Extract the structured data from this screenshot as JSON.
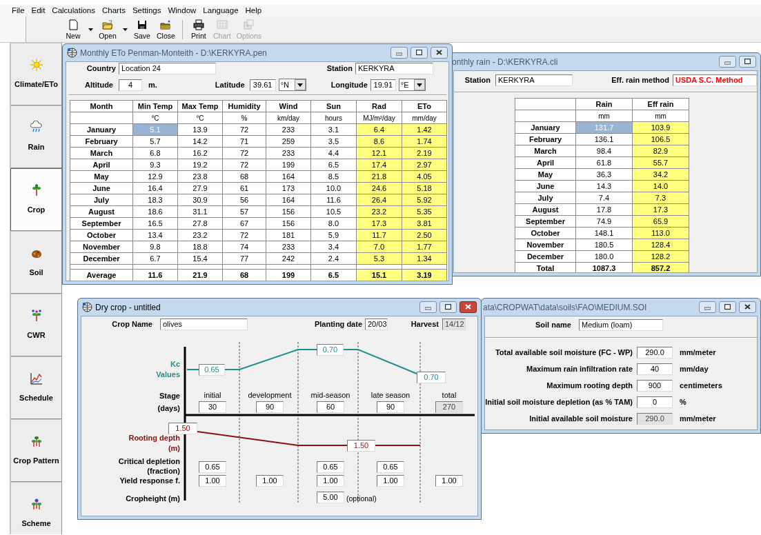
{
  "menu": [
    "File",
    "Edit",
    "Calculations",
    "Charts",
    "Settings",
    "Window",
    "Language",
    "Help"
  ],
  "toolbar": [
    {
      "label": "New",
      "dropdown": true,
      "disabled": false
    },
    {
      "label": "Open",
      "dropdown": true,
      "disabled": false
    },
    {
      "label": "Save",
      "dropdown": false,
      "disabled": false
    },
    {
      "label": "Close",
      "dropdown": false,
      "disabled": false
    },
    {
      "label": "Print",
      "dropdown": false,
      "disabled": false,
      "separator_before": true
    },
    {
      "label": "Chart",
      "dropdown": false,
      "disabled": true
    },
    {
      "label": "Options",
      "dropdown": false,
      "disabled": true
    }
  ],
  "sidebar": [
    {
      "label": "Climate/ETo",
      "selected": false
    },
    {
      "label": "Rain",
      "selected": false
    },
    {
      "label": "Crop",
      "selected": true
    },
    {
      "label": "Soil",
      "selected": false
    },
    {
      "label": "CWR",
      "selected": false
    },
    {
      "label": "Schedule",
      "selected": false
    },
    {
      "label": "Crop Pattern",
      "selected": false
    },
    {
      "label": "Scheme",
      "selected": false
    }
  ],
  "rain_window": {
    "title": "onthly rain - D:\\KERKYRA.cli",
    "active": false,
    "station": {
      "label": "Station",
      "value": "KERKYRA"
    },
    "eff_rain_method": {
      "label": "Eff. rain method",
      "value": "USDA S.C. Method"
    },
    "table": {
      "columns": [
        {
          "header": "Rain",
          "unit": "mm",
          "computed": false
        },
        {
          "header": "Eff rain",
          "unit": "mm",
          "computed": true
        }
      ],
      "rows": [
        {
          "month": "January",
          "values": [
            "131.7",
            "103.9"
          ],
          "selected": true
        },
        {
          "month": "February",
          "values": [
            "136.1",
            "106.5"
          ],
          "selected": false
        },
        {
          "month": "March",
          "values": [
            "98.4",
            "82.9"
          ],
          "selected": false
        },
        {
          "month": "April",
          "values": [
            "61.8",
            "55.7"
          ],
          "selected": false
        },
        {
          "month": "May",
          "values": [
            "36.3",
            "34.2"
          ],
          "selected": false
        },
        {
          "month": "June",
          "values": [
            "14.3",
            "14.0"
          ],
          "selected": false
        },
        {
          "month": "July",
          "values": [
            "7.4",
            "7.3"
          ],
          "selected": false
        },
        {
          "month": "August",
          "values": [
            "17.8",
            "17.3"
          ],
          "selected": false
        },
        {
          "month": "September",
          "values": [
            "74.9",
            "65.9"
          ],
          "selected": false
        },
        {
          "month": "October",
          "values": [
            "148.1",
            "113.0"
          ],
          "selected": false
        },
        {
          "month": "November",
          "values": [
            "180.5",
            "128.4"
          ],
          "selected": false
        },
        {
          "month": "December",
          "values": [
            "180.0",
            "128.2"
          ],
          "selected": false
        }
      ],
      "footer": {
        "label": "Total",
        "values": [
          "1087.3",
          "857.2"
        ]
      }
    }
  },
  "eto_window": {
    "title": "Monthly ETo Penman-Monteith - D:\\KERKYRA.pen",
    "active": false,
    "country": {
      "label": "Country",
      "value": "Location 24"
    },
    "station": {
      "label": "Station",
      "value": "KERKYRA"
    },
    "altitude": {
      "label": "Altitude",
      "value": "4",
      "unit": "m."
    },
    "latitude": {
      "label": "Latitude",
      "value": "39.61",
      "hemisphere": "°N"
    },
    "longitude": {
      "label": "Longitude",
      "value": "19.91",
      "hemisphere": "°E"
    },
    "table": {
      "first_header": "Month",
      "columns": [
        {
          "header": "Min Temp",
          "unit": "°C",
          "computed": false
        },
        {
          "header": "Max Temp",
          "unit": "°C",
          "computed": false
        },
        {
          "header": "Humidity",
          "unit": "%",
          "computed": false
        },
        {
          "header": "Wind",
          "unit": "km/day",
          "computed": false
        },
        {
          "header": "Sun",
          "unit": "hours",
          "computed": false
        },
        {
          "header": "Rad",
          "unit": "MJ/m²/day",
          "computed": true
        },
        {
          "header": "ETo",
          "unit": "mm/day",
          "computed": true
        }
      ],
      "rows": [
        {
          "month": "January",
          "values": [
            "5.1",
            "13.9",
            "72",
            "233",
            "3.1",
            "6.4",
            "1.42"
          ],
          "selected": true
        },
        {
          "month": "February",
          "values": [
            "5.7",
            "14.2",
            "71",
            "259",
            "3.5",
            "8.6",
            "1.74"
          ],
          "selected": false
        },
        {
          "month": "March",
          "values": [
            "6.8",
            "16.2",
            "72",
            "233",
            "4.4",
            "12.1",
            "2.19"
          ],
          "selected": false
        },
        {
          "month": "April",
          "values": [
            "9.3",
            "19.2",
            "72",
            "199",
            "6.5",
            "17.4",
            "2.97"
          ],
          "selected": false
        },
        {
          "month": "May",
          "values": [
            "12.9",
            "23.8",
            "68",
            "164",
            "8.5",
            "21.8",
            "4.05"
          ],
          "selected": false
        },
        {
          "month": "June",
          "values": [
            "16.4",
            "27.9",
            "61",
            "173",
            "10.0",
            "24.6",
            "5.18"
          ],
          "selected": false
        },
        {
          "month": "July",
          "values": [
            "18.3",
            "30.9",
            "56",
            "164",
            "11.6",
            "26.4",
            "5.92"
          ],
          "selected": false
        },
        {
          "month": "August",
          "values": [
            "18.6",
            "31.1",
            "57",
            "156",
            "10.5",
            "23.2",
            "5.35"
          ],
          "selected": false
        },
        {
          "month": "September",
          "values": [
            "16.5",
            "27.8",
            "67",
            "156",
            "8.0",
            "17.3",
            "3.81"
          ],
          "selected": false
        },
        {
          "month": "October",
          "values": [
            "13.4",
            "23.2",
            "72",
            "181",
            "5.9",
            "11.7",
            "2.50"
          ],
          "selected": false
        },
        {
          "month": "November",
          "values": [
            "9.8",
            "18.8",
            "74",
            "233",
            "3.4",
            "7.0",
            "1.77"
          ],
          "selected": false
        },
        {
          "month": "December",
          "values": [
            "6.7",
            "15.4",
            "77",
            "242",
            "2.4",
            "5.3",
            "1.34"
          ],
          "selected": false
        }
      ],
      "footer": {
        "label": "Average",
        "values": [
          "11.6",
          "21.9",
          "68",
          "199",
          "6.5",
          "15.1",
          "3.19"
        ]
      }
    }
  },
  "soil_window": {
    "title": "ata\\CROPWAT\\data\\soils\\FAO\\MEDIUM.SOI",
    "active": false,
    "soil_name": {
      "label": "Soil name",
      "value": "Medium (loam)"
    },
    "rows": [
      {
        "label": "Total available soil moisture (FC - WP)",
        "value": "290.0",
        "unit": "mm/meter",
        "readonly": false
      },
      {
        "label": "Maximum rain infiltration rate",
        "value": "40",
        "unit": "mm/day",
        "readonly": false
      },
      {
        "label": "Maximum rooting depth",
        "value": "900",
        "unit": "centimeters",
        "readonly": false
      },
      {
        "label": "Initial soil moisture depletion (as % TAM)",
        "value": "0",
        "unit": "%",
        "readonly": false
      },
      {
        "label": "Initial available soil moisture",
        "value": "290.0",
        "unit": "mm/meter",
        "readonly": true
      }
    ]
  },
  "crop_window": {
    "title": "Dry crop - untitled",
    "active": true,
    "crop_name": {
      "label": "Crop Name",
      "value": "olives"
    },
    "planting_date": {
      "label": "Planting date",
      "value": "20/03"
    },
    "harvest": {
      "label": "Harvest",
      "value": "14/12",
      "readonly": true
    },
    "kc": {
      "label_lines": [
        "Kc",
        "Values"
      ],
      "values": [
        "0.65",
        "0.70",
        "0.70"
      ]
    },
    "stages": {
      "label_lines": [
        "Stage",
        "(days)"
      ],
      "items": [
        {
          "name": "initial",
          "days": "30",
          "readonly": false,
          "critical_depletion": "0.65",
          "yield_response": "1.00"
        },
        {
          "name": "development",
          "days": "90",
          "readonly": false,
          "yield_response": "1.00"
        },
        {
          "name": "mid-season",
          "days": "60",
          "readonly": false,
          "critical_depletion": "0.65",
          "yield_response": "1.00"
        },
        {
          "name": "late season",
          "days": "90",
          "readonly": false,
          "critical_depletion": "0.65",
          "yield_response": "1.00"
        },
        {
          "name": "total",
          "days": "270",
          "readonly": true,
          "yield_response": "1.00"
        }
      ]
    },
    "rooting_depth": {
      "label_lines": [
        "Rooting depth",
        "(m)"
      ],
      "values": [
        "1.50",
        "1.50"
      ]
    },
    "critical_depletion": {
      "label_lines": [
        "Critical depletion",
        "(fraction)"
      ]
    },
    "yield_response": {
      "label": "Yield response f."
    },
    "cropheight": {
      "label": "Cropheight (m)",
      "value": "5.00",
      "note": "(optional)"
    }
  }
}
